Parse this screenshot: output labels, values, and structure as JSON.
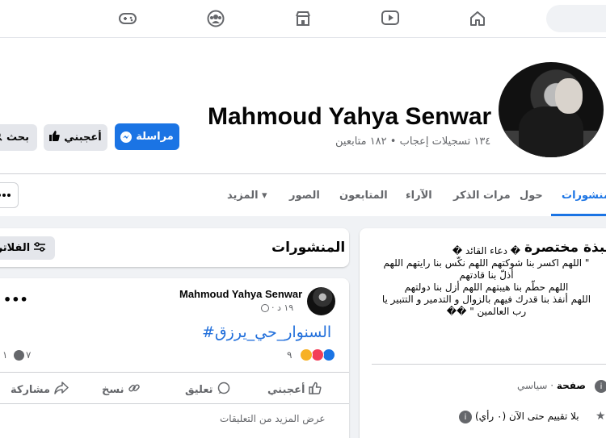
{
  "nav": {
    "icons": [
      "gaming-icon",
      "groups-icon",
      "marketplace-icon",
      "watch-icon",
      "home-icon"
    ]
  },
  "profile": {
    "name": "Mahmoud Yahya Senwar",
    "stats": "١٣٤ تسجيلات إعجاب • ١٨٢ متابعين",
    "buttons": {
      "message": "مراسلة",
      "like": "أعجبني",
      "search": "بحث"
    }
  },
  "tabs": [
    {
      "label": "المنشورات",
      "active": true
    },
    {
      "label": "حول"
    },
    {
      "label": "مرات الذكر"
    },
    {
      "label": "الآراء"
    },
    {
      "label": "المتابعون"
    },
    {
      "label": "الصور"
    },
    {
      "label": "المزيد ▾"
    }
  ],
  "intro": {
    "title": "نبذة مختصرة",
    "bio_lines": [
      "� دعاء القائد �",
      "\" اللهم اكسر بنا شوكتهم اللهم نكّس بنا رايتهم اللهم",
      "أذلّ بنا قادتهم",
      "اللهم حطّم بنا هيبتهم اللهم أزل بنا دولتهم",
      "اللهم أنفذ بنا قدرك فيهم بالزوال و التدمير و التتبير يا",
      "رب العالمين \" ��"
    ],
    "category_prefix": "صفحة",
    "category": " · سياسي",
    "rating": "بلا تقييم حتى الآن (٠ رأي)"
  },
  "posts_header": {
    "title": "المنشورات",
    "filters_label": "الفلاتر"
  },
  "post": {
    "author": "Mahmoud Yahya Senwar",
    "time": "١٩ د ·",
    "hashtag": "#السنوار_حي_يرزق",
    "reactions_count": "٩",
    "comments_count": "٧",
    "shares_count": "١",
    "actions": {
      "like": "أعجبني",
      "comment": "تعليق",
      "copy": "نسخ",
      "share": "مشاركة"
    },
    "more_comments": "عرض المزيد من التعليقات"
  },
  "colors": {
    "accent": "#1b74e4",
    "background": "#f0f2f5",
    "muted_text": "#65676b"
  }
}
